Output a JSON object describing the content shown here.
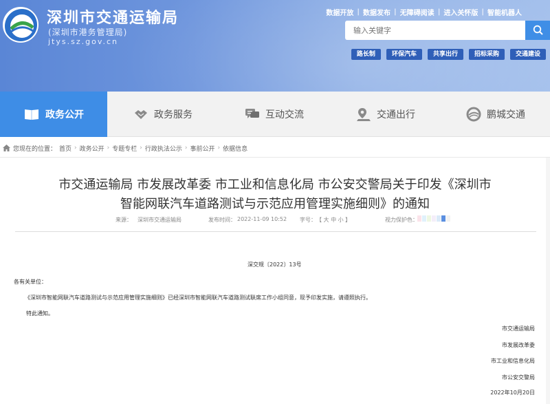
{
  "header": {
    "site_title": "深圳市交通运输局",
    "site_subtitle": "(深圳市港务管理局)",
    "site_url": "jtys.sz.gov.cn",
    "top_links": [
      "数据开放",
      "数据发布",
      "无障碍阅读",
      "进入关怀版",
      "智能机器人"
    ],
    "search_placeholder": "输入关键字",
    "quick_links": [
      "路长制",
      "环保汽车",
      "共享出行",
      "招标采购",
      "交通建设"
    ]
  },
  "nav": {
    "items": [
      {
        "label": "政务公开",
        "icon": "book-icon",
        "active": true
      },
      {
        "label": "政务服务",
        "icon": "handshake-icon",
        "active": false
      },
      {
        "label": "互动交流",
        "icon": "chat-icon",
        "active": false
      },
      {
        "label": "交通出行",
        "icon": "map-pin-icon",
        "active": false
      },
      {
        "label": "鹏城交通",
        "icon": "ring-logo-icon",
        "active": false
      }
    ]
  },
  "breadcrumb": {
    "prefix": "您现在的位置：",
    "items": [
      "首页",
      "政务公开",
      "专题专栏",
      "行政执法公示",
      "事前公开",
      "依据信息"
    ]
  },
  "article": {
    "title_line1": "市交通运输局 市发展改革委 市工业和信息化局 市公安交警局关于印发《深圳市",
    "title_line2": "智能网联汽车道路测试与示范应用管理实施细则》的通知",
    "source_label": "来源：",
    "source_value": "深圳市交通运输局",
    "date_label": "发布时间：",
    "date_value": "2022-11-09 10:52",
    "font_label": "字号：",
    "font_sizes": "【 大 中 小 】",
    "vision_label": "视力保护色：",
    "doc_number": "深交规〔2022〕13号",
    "greeting": "各有关单位：",
    "paragraph": "《深圳市智能网联汽车道路测试与示范应用管理实施细则》已经深圳市智能网联汽车道路测试联席工作小组同意，现予印发实施，请遵照执行。",
    "closing": "特此通知。",
    "signatures": [
      "市交通运输局",
      "市发展改革委",
      "市工业和信息化局",
      "市公安交警局"
    ],
    "date_signed": "2022年10月20日"
  },
  "colors": {
    "accent": "#3e8de6",
    "swatches": [
      "#fbe3ea",
      "#e0f1fb",
      "#eef7e2",
      "#f4eef9",
      "#dbeaf8",
      "#5b8fe0",
      "#f2f2f2"
    ]
  }
}
